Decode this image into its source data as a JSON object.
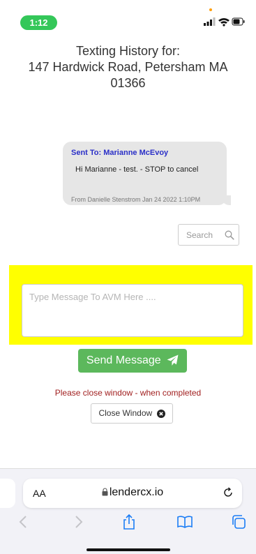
{
  "status_bar": {
    "time": "1:12"
  },
  "header": {
    "title_line1": "Texting History for:",
    "title_line2": "147 Hardwick Road, Petersham MA",
    "title_line3": "01366"
  },
  "message": {
    "sent_to": "Sent To: Marianne McEvoy",
    "body": "Hi Marianne - test. - STOP to cancel",
    "meta": "From Danielle Stenstrom Jan 24 2022 1:10PM"
  },
  "search": {
    "placeholder": "Search"
  },
  "compose": {
    "placeholder": "Type Message To AVM Here ....",
    "send_label": "Send Message"
  },
  "notice": "Please close window - when completed",
  "close_label": "Close Window",
  "browser": {
    "text_size_label": "AA",
    "url": "lendercx.io"
  },
  "colors": {
    "highlight": "#ffff00",
    "send_button": "#5cb85c",
    "sent_to": "#2a2fc7",
    "notice": "#a12020",
    "time_pill": "#34c759"
  }
}
